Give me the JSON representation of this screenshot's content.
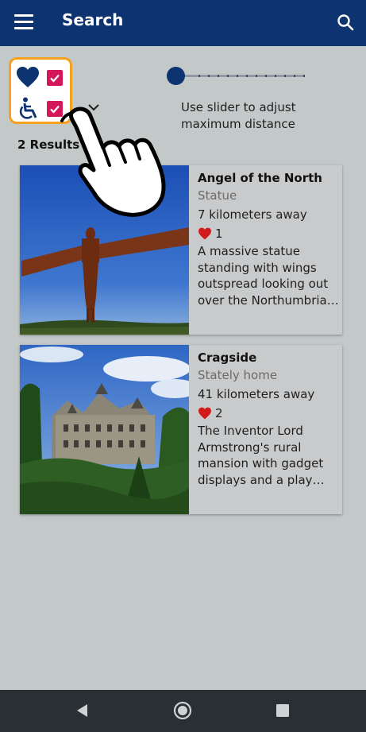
{
  "app_bar": {
    "title": "Search",
    "background_color": "#0d3370",
    "left_icon": "menu-icon",
    "right_icon": "search-icon"
  },
  "filters": {
    "favorites": {
      "icon": "heart-icon",
      "checked": true
    },
    "accessible": {
      "icon": "wheelchair-icon",
      "checked": true
    },
    "border_color": "#f5a11c",
    "checkbox_color": "#d3175a",
    "expand_icon": "chevron-down-icon"
  },
  "distance_slider": {
    "value_fraction": 0,
    "hint": "Use slider to adjust maximum distance"
  },
  "results": {
    "count_label": "2 Results",
    "items": [
      {
        "title": "Angel of the North",
        "type": "Statue",
        "distance": "7 kilometers away",
        "likes": "1",
        "description": "A massive statue standing with wings outspread looking out over the Northumbrian landscape"
      },
      {
        "title": "Cragside",
        "type": "Stately home",
        "distance": "41 kilometers away",
        "likes": "2",
        "description": "The Inventor Lord Armstrong's rural mansion with gadget displays and a play area"
      }
    ]
  },
  "overlay": {
    "icon": "pointing-hand-icon"
  },
  "nav_bar": {
    "back_icon": "back-triangle-icon",
    "home_icon": "home-circle-icon",
    "recents_icon": "recents-square-icon"
  }
}
